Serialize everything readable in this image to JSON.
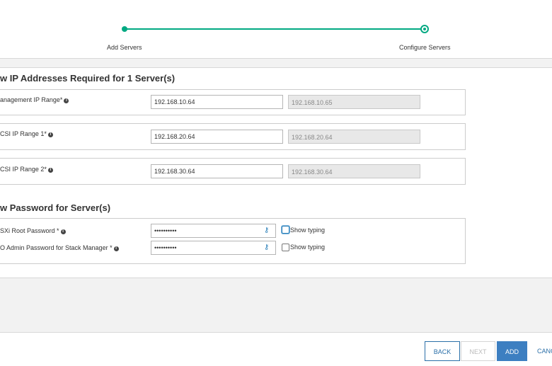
{
  "stepper": {
    "steps": [
      {
        "label": "Add Servers",
        "state": "complete"
      },
      {
        "label": "Configure Servers",
        "state": "current"
      }
    ],
    "accent_color": "#01a982"
  },
  "ip_section": {
    "title": "w IP Addresses Required for 1 Server(s)",
    "rows": [
      {
        "label": "anagement IP Range*",
        "value": "192.168.10.64",
        "end_value": "192.168.10.65"
      },
      {
        "label": "CSI IP Range 1*",
        "value": "192.168.20.64",
        "end_value": "192.168.20.64"
      },
      {
        "label": "CSI IP Range 2*",
        "value": "192.168.30.64",
        "end_value": "192.168.30.64"
      }
    ]
  },
  "password_section": {
    "title": "w Password for Server(s)",
    "rows": [
      {
        "label": "SXi Root Password *",
        "value": "••••••••••",
        "show_typing": "Show typing"
      },
      {
        "label": "O Admin Password for Stack Manager *",
        "value": "••••••••••",
        "show_typing": "Show typing"
      }
    ]
  },
  "footer": {
    "back": "BACK",
    "next": "NEXT",
    "add": "ADD",
    "cancel": "CANC"
  },
  "icons": {
    "info": "info-icon",
    "password_reveal": "key-icon"
  }
}
